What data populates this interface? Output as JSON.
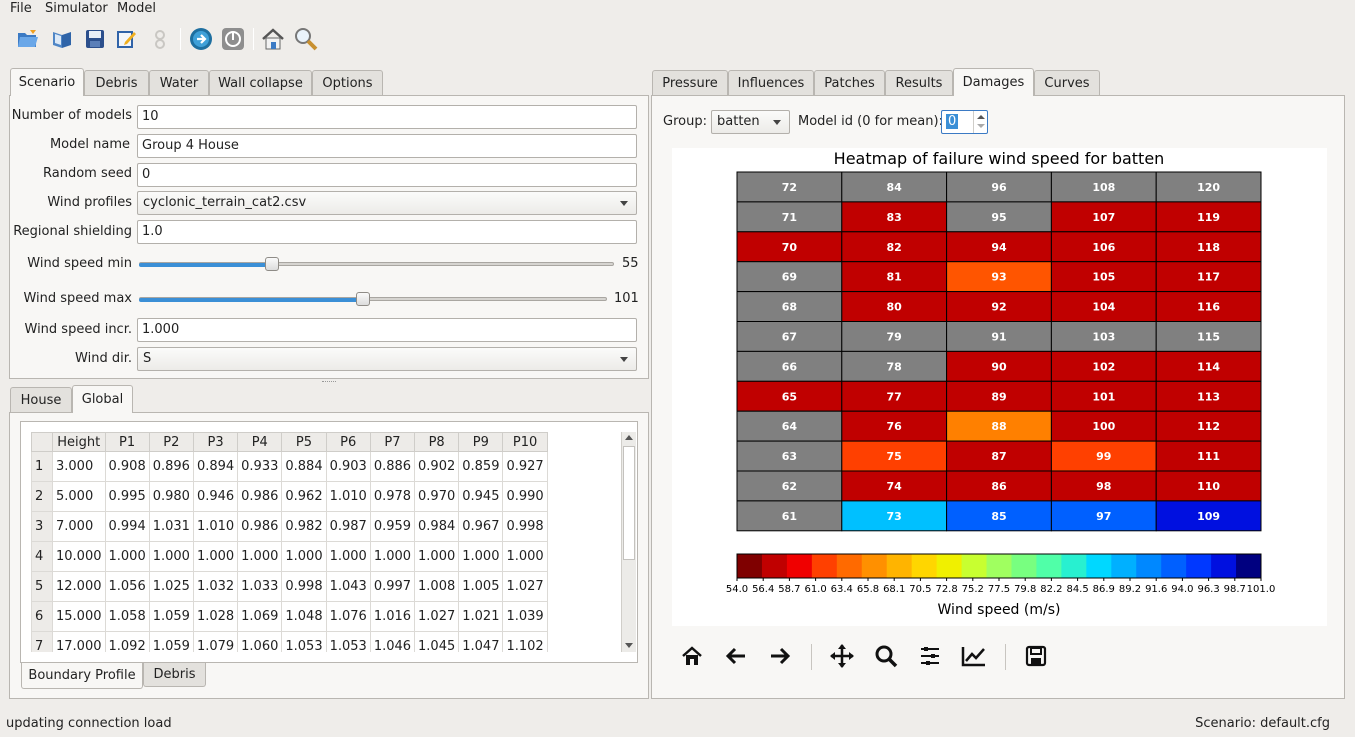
{
  "menu": [
    "File",
    "Simulator",
    "Model"
  ],
  "toolbar_icons": [
    "open-folder-icon",
    "book-icon",
    "save-icon",
    "edit-icon",
    "settings-disabled-icon",
    "run-icon",
    "stop-icon",
    "home-icon",
    "search-icon"
  ],
  "left_tabs": [
    "Scenario",
    "Debris",
    "Water",
    "Wall collapse",
    "Options"
  ],
  "scenario": {
    "num_models_label": "Number of models",
    "num_models": "10",
    "model_name_label": "Model name",
    "model_name": "Group 4 House",
    "random_seed_label": "Random seed",
    "random_seed": "0",
    "wind_profiles_label": "Wind profiles",
    "wind_profiles": "cyclonic_terrain_cat2.csv",
    "regional_shielding_label": "Regional shielding",
    "regional_shielding": "1.0",
    "wind_speed_min_label": "Wind speed min",
    "wind_speed_min": "55",
    "wind_speed_min_pos": 0.25,
    "wind_speed_max_label": "Wind speed max",
    "wind_speed_max": "101",
    "wind_speed_max_pos": 0.48,
    "wind_speed_incr_label": "Wind speed incr.",
    "wind_speed_incr": "1.000",
    "wind_dir_label": "Wind dir.",
    "wind_dir": "S"
  },
  "lower_tabs": [
    "House",
    "Global"
  ],
  "profile_table": {
    "headers": [
      "Height",
      "P1",
      "P2",
      "P3",
      "P4",
      "P5",
      "P6",
      "P7",
      "P8",
      "P9",
      "P10"
    ],
    "rows": [
      [
        "1",
        "3.000",
        "0.908",
        "0.896",
        "0.894",
        "0.933",
        "0.884",
        "0.903",
        "0.886",
        "0.902",
        "0.859",
        "0.927"
      ],
      [
        "2",
        "5.000",
        "0.995",
        "0.980",
        "0.946",
        "0.986",
        "0.962",
        "1.010",
        "0.978",
        "0.970",
        "0.945",
        "0.990"
      ],
      [
        "3",
        "7.000",
        "0.994",
        "1.031",
        "1.010",
        "0.986",
        "0.982",
        "0.987",
        "0.959",
        "0.984",
        "0.967",
        "0.998"
      ],
      [
        "4",
        "10.000",
        "1.000",
        "1.000",
        "1.000",
        "1.000",
        "1.000",
        "1.000",
        "1.000",
        "1.000",
        "1.000",
        "1.000"
      ],
      [
        "5",
        "12.000",
        "1.056",
        "1.025",
        "1.032",
        "1.033",
        "0.998",
        "1.043",
        "0.997",
        "1.008",
        "1.005",
        "1.027"
      ],
      [
        "6",
        "15.000",
        "1.058",
        "1.059",
        "1.028",
        "1.069",
        "1.048",
        "1.076",
        "1.016",
        "1.027",
        "1.021",
        "1.039"
      ],
      [
        "7",
        "17.000",
        "1.092",
        "1.059",
        "1.079",
        "1.060",
        "1.053",
        "1.053",
        "1.046",
        "1.045",
        "1.047",
        "1.102"
      ]
    ]
  },
  "bottom_tabs": [
    "Boundary Profile",
    "Debris"
  ],
  "right_tabs": [
    "Pressure",
    "Influences",
    "Patches",
    "Results",
    "Damages",
    "Curves"
  ],
  "damages": {
    "group_label": "Group:",
    "group_value": "batten",
    "model_id_label": "Model id (0 for mean):",
    "model_id_value": "0"
  },
  "chart_data": {
    "type": "heatmap",
    "title": "Heatmap of failure wind speed for batten",
    "colorbar_label": "Wind speed (m/s)",
    "colorbar_ticks": [
      "54.0",
      "56.4",
      "58.7",
      "61.0",
      "63.4",
      "65.8",
      "68.1",
      "70.5",
      "72.8",
      "75.2",
      "77.5",
      "79.8",
      "82.2",
      "84.5",
      "86.9",
      "89.2",
      "91.6",
      "94.0",
      "96.3",
      "98.7",
      "101.0"
    ],
    "columns": [
      [
        "72",
        "71",
        "70",
        "69",
        "68",
        "67",
        "66",
        "65",
        "64",
        "63",
        "62",
        "61"
      ],
      [
        "84",
        "83",
        "82",
        "81",
        "80",
        "79",
        "78",
        "77",
        "76",
        "75",
        "74",
        "73"
      ],
      [
        "96",
        "95",
        "94",
        "93",
        "92",
        "91",
        "90",
        "89",
        "88",
        "87",
        "86",
        "85"
      ],
      [
        "108",
        "107",
        "106",
        "105",
        "104",
        "103",
        "102",
        "101",
        "100",
        "99",
        "98",
        "97"
      ],
      [
        "120",
        "119",
        "118",
        "117",
        "116",
        "115",
        "114",
        "113",
        "112",
        "111",
        "110",
        "109"
      ]
    ],
    "colors": [
      [
        "#808080",
        "#808080",
        "#c00000",
        "#808080",
        "#808080",
        "#808080",
        "#808080",
        "#c00000",
        "#808080",
        "#808080",
        "#808080",
        "#808080"
      ],
      [
        "#808080",
        "#c00000",
        "#c00000",
        "#c00000",
        "#c00000",
        "#808080",
        "#808080",
        "#c00000",
        "#c00000",
        "#ff4000",
        "#c00000",
        "#00c0ff"
      ],
      [
        "#808080",
        "#808080",
        "#c00000",
        "#ff5500",
        "#c00000",
        "#808080",
        "#c00000",
        "#c00000",
        "#ff8000",
        "#c00000",
        "#c00000",
        "#0060ff"
      ],
      [
        "#808080",
        "#c00000",
        "#c00000",
        "#c00000",
        "#c00000",
        "#808080",
        "#c00000",
        "#c00000",
        "#c00000",
        "#ff4000",
        "#c00000",
        "#0060ff"
      ],
      [
        "#808080",
        "#c00000",
        "#c00000",
        "#c00000",
        "#c00000",
        "#808080",
        "#c00000",
        "#c00000",
        "#c00000",
        "#c00000",
        "#c00000",
        "#0010e0"
      ]
    ],
    "colormap": [
      "#7f0000",
      "#c00000",
      "#f00000",
      "#ff4000",
      "#ff6a00",
      "#ff9000",
      "#ffb400",
      "#ffd600",
      "#f0f000",
      "#c8ff30",
      "#a0ff60",
      "#78ff80",
      "#50ffa8",
      "#28f0d0",
      "#00d8ff",
      "#00b0ff",
      "#0088ff",
      "#0060ff",
      "#0038ff",
      "#0010e0",
      "#000080"
    ]
  },
  "nav_icons": [
    "home-icon",
    "back-arrow-icon",
    "forward-arrow-icon",
    "pan-icon",
    "zoom-icon",
    "subplots-icon",
    "axes-edit-icon",
    "save-figure-icon"
  ],
  "status": {
    "message": "updating connection load",
    "scenario": "Scenario: default.cfg"
  }
}
